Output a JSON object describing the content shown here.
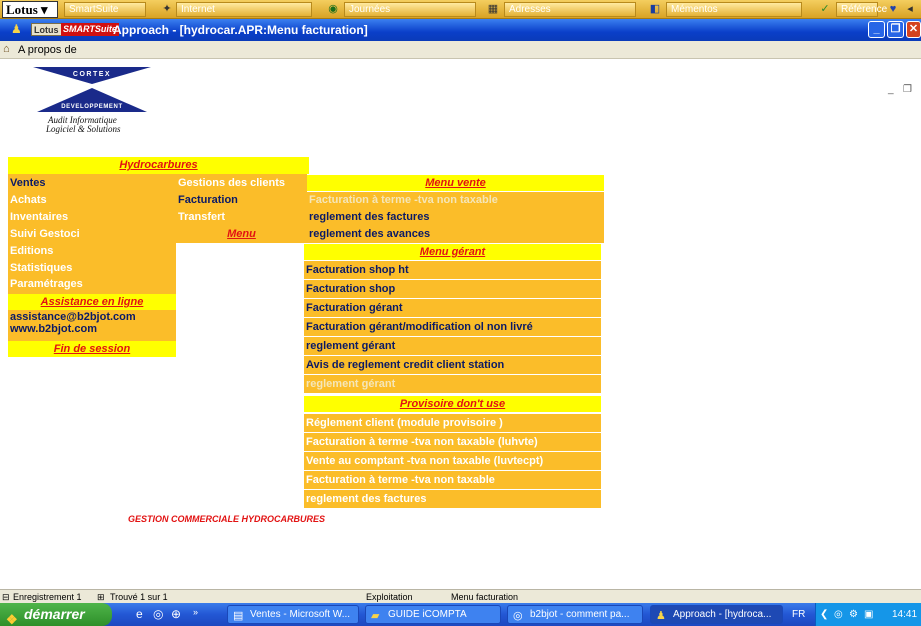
{
  "suitebar": {
    "logo": "Lotus",
    "items": [
      "SmartSuite",
      "Internet",
      "Journées",
      "Adresses",
      "Mémentos",
      "Référence"
    ]
  },
  "titlebar": {
    "badge": "Lotus",
    "badge2": "SMARTSuite",
    "title": "Approach - [hydrocar.APR:Menu facturation]"
  },
  "menubar": {
    "item": "A propos de"
  },
  "logo": {
    "top_text": "CORTEX",
    "bottom_text": "DEVELOPPEMENT",
    "line1": "Audit Informatique",
    "line2": "Logiciel & Solutions"
  },
  "left_menu": {
    "header": "Hydrocarbures",
    "items": [
      "Ventes",
      "Achats",
      "Inventaires",
      "Suivi Gestoci",
      "Editions",
      "Statistiques",
      "Paramétrages"
    ],
    "assistance_header": "Assistance en ligne",
    "email": "assistance@b2bjot.com",
    "website": "www.b2bjot.com",
    "fin": "Fin de session"
  },
  "sub_menu": {
    "items": [
      "Gestions des clients",
      "Facturation",
      "Transfert"
    ],
    "menu_label": "Menu"
  },
  "menu_vente": {
    "header": "Menu vente",
    "items": [
      "Facturation à terme -tva non taxable",
      "reglement des factures",
      "reglement des avances"
    ]
  },
  "menu_gerant": {
    "header": "Menu gérant",
    "items": [
      "Facturation shop ht",
      "Facturation shop",
      "Facturation gérant",
      "Facturation gérant/modification ol non livré",
      "reglement gérant",
      "Avis de reglement credit client station",
      "reglement gérant"
    ]
  },
  "provisoire": {
    "header": "Provisoire don't use",
    "items": [
      "Réglement client (module provisoire )",
      "Facturation à terme -tva non taxable (luhvte)",
      "Vente au comptant -tva non taxable (luvtecpt)",
      "Facturation à terme -tva non taxable",
      "reglement des factures"
    ]
  },
  "footer_title": "GESTION COMMERCIALE HYDROCARBURES",
  "statusbar": {
    "record": "Enregistrement 1",
    "found": "Trouvé 1 sur 1",
    "mode": "Exploitation",
    "view": "Menu facturation"
  },
  "taskbar": {
    "start": "démarrer",
    "buttons": [
      "Ventes - Microsoft W...",
      "GUIDE iCOMPTA",
      "b2bjot - comment pa...",
      "Approach - [hydroca..."
    ],
    "lang": "FR",
    "time": "14:41"
  },
  "colors": {
    "menu_orange": "#fbbd29",
    "header_yellow": "#ffff00",
    "header_red": "#e21212",
    "selected_blue": "#0b1a66"
  }
}
